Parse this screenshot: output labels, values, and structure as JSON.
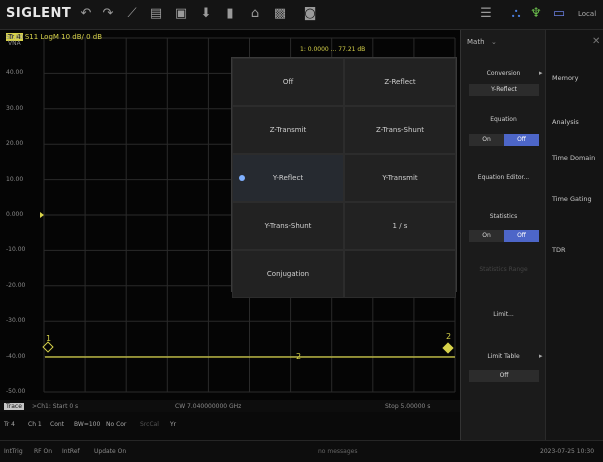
{
  "toolbar": {
    "logo": "SIGLENT",
    "local_label": "Local"
  },
  "chart": {
    "title_trace": "Tr 4",
    "title_rest": "S11 LogM 10 dB/ 0 dB",
    "vna_label": "VNA",
    "marker_readout": "1:   0.0000 ... 77.21 dB",
    "y_ticks": [
      "50.00",
      "40.00",
      "30.00",
      "20.00",
      "10.00",
      "0.000",
      "-10.00",
      "-20.00",
      "-30.00",
      "-40.00",
      "-50.00"
    ],
    "markers": [
      "1",
      "2",
      "2"
    ]
  },
  "status1": {
    "left": "Trace",
    "start": ">Ch1: Start 0 s",
    "center": "CW 7.040000000 GHz",
    "stop": "Stop 5.00000 s"
  },
  "status2": [
    "Tr 4",
    "Ch 1",
    "Cont",
    "BW=100",
    "No Cor",
    "SrcCal",
    "Yr"
  ],
  "status3": {
    "items": [
      "IntTrig",
      "RF On",
      "IntRef",
      "Update On"
    ],
    "messages": "no messages",
    "datetime": "2023-07-25 10:30"
  },
  "popup": {
    "items": [
      "Off",
      "Z-Reflect",
      "Z-Transmit",
      "Z-Trans-Shunt",
      "Y-Reflect",
      "Y-Transmit",
      "Y-Trans-Shunt",
      "1 / s",
      "Conjugation"
    ],
    "selected": "Y-Reflect"
  },
  "mathpanel": {
    "title": "Math",
    "conversion_label": "Conversion",
    "conversion_value": "Y-Reflect",
    "equation_label": "Equation",
    "on": "On",
    "off": "Off",
    "equation_editor": "Equation Editor...",
    "statistics_label": "Statistics",
    "statistics_type": "Statistics Range",
    "limit": "Limit...",
    "limit_table_label": "Limit Table",
    "limit_table_value": "Off"
  },
  "rightpanel": {
    "items": [
      "Memory",
      "Analysis",
      "Time Domain",
      "Time Gating",
      "TDR"
    ]
  }
}
